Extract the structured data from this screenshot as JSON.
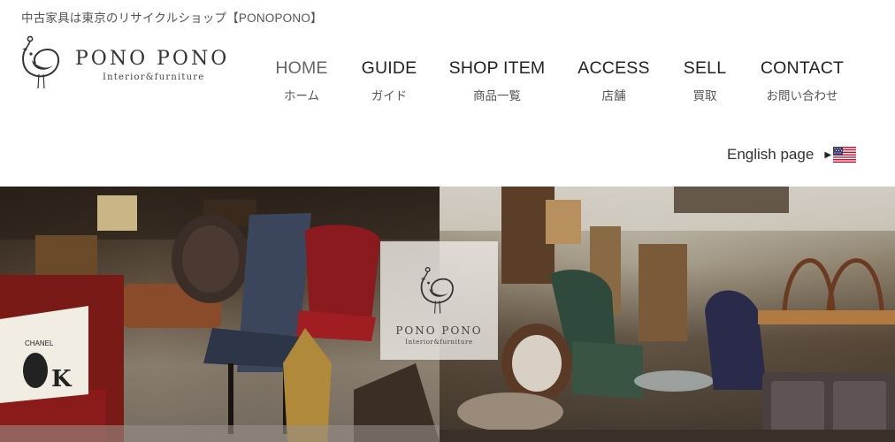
{
  "header": {
    "tagline": "中古家具は東京のリサイクルショップ【PONOPONO】",
    "logo": {
      "name": "PONO PONO",
      "subtitle": "Interior&furniture"
    }
  },
  "nav": {
    "items": [
      {
        "en": "HOME",
        "jp": "ホーム",
        "active": true
      },
      {
        "en": "GUIDE",
        "jp": "ガイド"
      },
      {
        "en": "SHOP ITEM",
        "jp": "商品一覧"
      },
      {
        "en": "ACCESS",
        "jp": "店舗"
      },
      {
        "en": "SELL",
        "jp": "買取"
      },
      {
        "en": "CONTACT",
        "jp": "お問い合わせ"
      }
    ]
  },
  "english_link": {
    "label": "English page",
    "arrow_icon": "triangle-right-icon",
    "flag_icon": "us-flag-icon"
  },
  "hero": {
    "overlay_logo": {
      "name": "PONO PONO",
      "subtitle": "Interior&furniture"
    },
    "pillow_text": {
      "brand": "CHANEL",
      "letter": "K"
    }
  },
  "colors": {
    "text": "#333333",
    "nav_active": "#666666",
    "accent_red": "#8b1a1a"
  }
}
